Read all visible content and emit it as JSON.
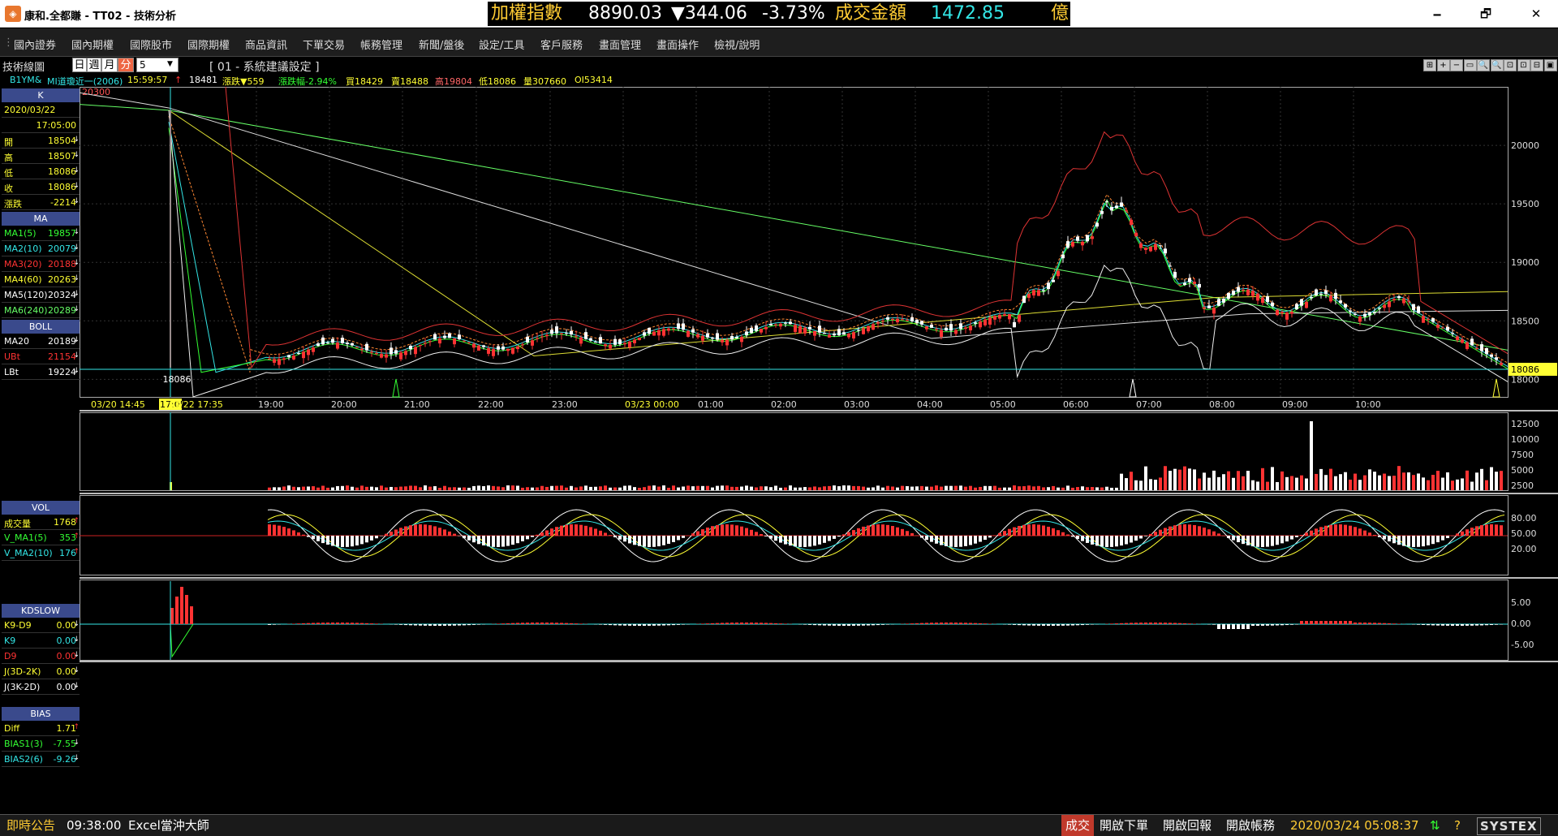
{
  "window": {
    "title": "康和.全都賺 - TT02 - 技術分析",
    "minimize": "🗕",
    "maximize": "🗗",
    "close": "✕"
  },
  "ticker": {
    "name": "加權指數",
    "price": "8890.03",
    "change": "▼344.06",
    "pct": "-3.73%",
    "vol_label": "成交金額",
    "vol_value": "1472.85",
    "unit": "億"
  },
  "menu": [
    "國內證券",
    "國內期權",
    "國際股市",
    "國際期權",
    "商品資訊",
    "下單交易",
    "帳務管理",
    "新聞/盤後",
    "設定/工具",
    "客戶服務",
    "畫面管理",
    "畫面操作",
    "檢視/說明"
  ],
  "toolbar": {
    "title": "技術線圖",
    "periods": [
      "日",
      "週",
      "月",
      "分"
    ],
    "interval": "5",
    "setting": "[ 01 - 系統建議設定 ]",
    "icons": [
      "⊞",
      "+",
      "−",
      "▭",
      "🔍",
      "🔍",
      "⊡",
      "⊡",
      "⊟",
      "▣"
    ]
  },
  "quote": {
    "symbol": "B1YM&",
    "name": "MI道瓊近一(2006)",
    "time": "15:59:57",
    "last": "18481",
    "change": "漲跌▼559",
    "pct": "漲跌幅-2.94%",
    "bid": "買18429",
    "ask": "賣18488",
    "high": "高19804",
    "low": "低18086",
    "volume": "量307660",
    "oi": "OI53414"
  },
  "panel": {
    "k": {
      "header": "K",
      "date": "2020/03/22",
      "time": "17:05:00",
      "rows": [
        {
          "label": "開",
          "value": "18504"
        },
        {
          "label": "高",
          "value": "18507"
        },
        {
          "label": "低",
          "value": "18086"
        },
        {
          "label": "收",
          "value": "18086"
        },
        {
          "label": "漲跌",
          "value": "-2214"
        }
      ]
    },
    "ma": {
      "header": "MA",
      "rows": [
        {
          "label": "MA1(5)",
          "value": "19857",
          "color": "#33ff33"
        },
        {
          "label": "MA2(10)",
          "value": "20079",
          "color": "#33e6e6"
        },
        {
          "label": "MA3(20)",
          "value": "20188",
          "color": "#ff3333"
        },
        {
          "label": "MA4(60)",
          "value": "20263",
          "color": "#ffff33"
        },
        {
          "label": "MA5(120)",
          "value": "20324",
          "color": "#ffffff"
        },
        {
          "label": "MA6(240)",
          "value": "20289",
          "color": "#66ff66"
        }
      ]
    },
    "boll": {
      "header": "BOLL",
      "rows": [
        {
          "label": "MA20",
          "value": "20189",
          "color": "#ffffff"
        },
        {
          "label": "UBt",
          "value": "21154",
          "color": "#ff3333"
        },
        {
          "label": "LBt",
          "value": "19224",
          "color": "#ffffff"
        }
      ]
    },
    "vol": {
      "header": "VOL",
      "rows": [
        {
          "label": "成交量",
          "value": "1768",
          "color": "#ffff33"
        },
        {
          "label": "V_MA1(5)",
          "value": "353",
          "color": "#33ff33"
        },
        {
          "label": "V_MA2(10)",
          "value": "176",
          "color": "#33e6e6"
        }
      ]
    },
    "kd": {
      "header": "KDSLOW",
      "rows": [
        {
          "label": "K9-D9",
          "value": "0.00",
          "color": "#ffff33"
        },
        {
          "label": "K9",
          "value": "0.00",
          "color": "#33e6e6"
        },
        {
          "label": "D9",
          "value": "0.00",
          "color": "#ff3333"
        },
        {
          "label": "J(3D-2K)",
          "value": "0.00",
          "color": "#ffff33"
        },
        {
          "label": "J(3K-2D)",
          "value": "0.00",
          "color": "#ffffff"
        }
      ]
    },
    "bias": {
      "header": "BIAS",
      "rows": [
        {
          "label": "Diff",
          "value": "1.71",
          "color": "#ffff33"
        },
        {
          "label": "BIAS1(3)",
          "value": "-7.55",
          "color": "#33ff33"
        },
        {
          "label": "BIAS2(6)",
          "value": "-9.26",
          "color": "#33e6e6"
        }
      ]
    }
  },
  "chart_data": {
    "type": "candlestick",
    "price_axis": [
      "20000",
      "19500",
      "19000",
      "18500",
      "18000"
    ],
    "ylim": [
      17850,
      20500
    ],
    "top_label": "20300",
    "low_label": "18086",
    "last_label": "18086",
    "time_labels": [
      "03/20 14:45",
      "17:05",
      "03/22 17:35",
      "19:00",
      "20:00",
      "21:00",
      "22:00",
      "23:00",
      "03/23 00:00",
      "01:00",
      "02:00",
      "03:00",
      "04:00",
      "05:00",
      "06:00",
      "07:00",
      "08:00",
      "09:00",
      "10:00"
    ],
    "volume_axis": [
      "12500",
      "10000",
      "7500",
      "5000",
      "2500"
    ],
    "kd_axis": [
      "80.00",
      "50.00",
      "20.00"
    ],
    "bias_axis": [
      "5.00",
      "0.00",
      "-5.00"
    ]
  },
  "status": {
    "announce": "即時公告",
    "time": "09:38:00",
    "message": "Excel當沖大師",
    "trade": "成交",
    "btn_order": "開啟下單",
    "btn_report": "開啟回報",
    "btn_account": "開啟帳務",
    "datetime": "2020/03/24 05:08:37",
    "brand": "SYSTEX"
  }
}
